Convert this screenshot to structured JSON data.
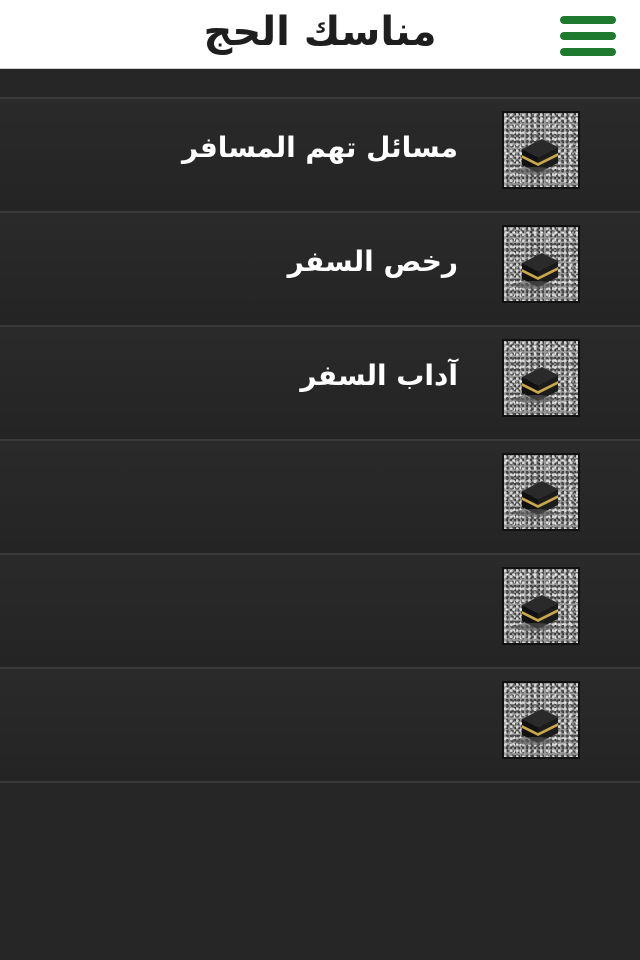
{
  "header": {
    "title": "مناسك الحج",
    "menu_icon": "hamburger-menu-icon",
    "accent_color": "#1e7a2e"
  },
  "list": {
    "items": [
      {
        "label": "مسائل تهم المسافر",
        "icon": "kaaba-thumbnail-icon"
      },
      {
        "label": "رخص السفر",
        "icon": "kaaba-thumbnail-icon"
      },
      {
        "label": "آداب السفر",
        "icon": "kaaba-thumbnail-icon"
      },
      {
        "label": "",
        "icon": "kaaba-thumbnail-icon"
      },
      {
        "label": "",
        "icon": "kaaba-thumbnail-icon"
      },
      {
        "label": "",
        "icon": "kaaba-thumbnail-icon"
      }
    ]
  }
}
